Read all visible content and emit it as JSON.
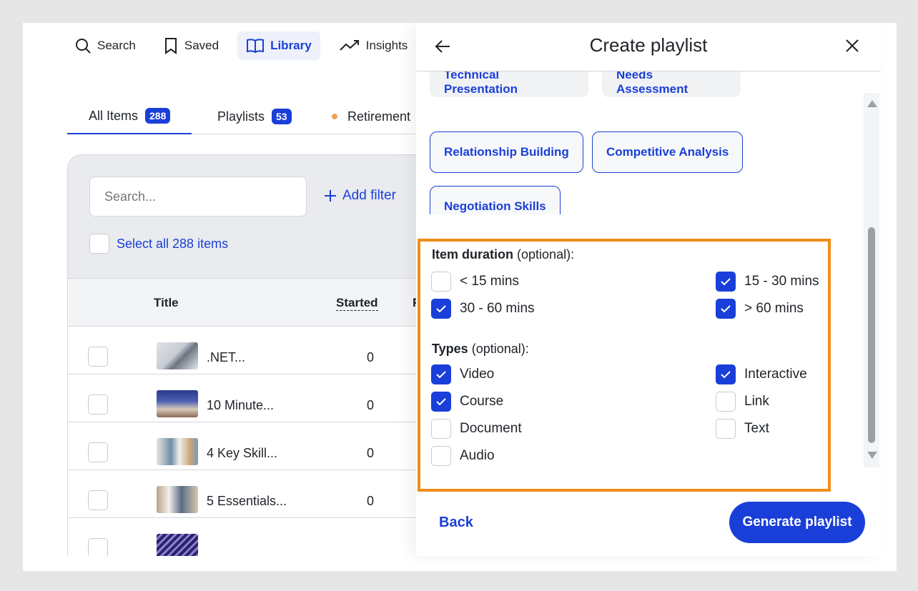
{
  "nav": {
    "items": [
      {
        "label": "Search",
        "icon": "search-icon",
        "active": false
      },
      {
        "label": "Saved",
        "icon": "bookmark-icon",
        "active": false
      },
      {
        "label": "Library",
        "icon": "book-icon",
        "active": true
      },
      {
        "label": "Insights",
        "icon": "trend-icon",
        "active": false
      }
    ]
  },
  "tabs": {
    "all_items": {
      "label": "All Items",
      "count": "288"
    },
    "playlists": {
      "label": "Playlists",
      "count": "53"
    },
    "retirement": {
      "label": "Retirement"
    }
  },
  "library": {
    "search_placeholder": "Search...",
    "add_filter": "Add filter",
    "select_all": "Select all 288 items",
    "columns": {
      "title": "Title",
      "started": "Started",
      "extra": "F"
    },
    "rows": [
      {
        "title": ".NET...",
        "started": "0"
      },
      {
        "title": "10 Minute...",
        "started": "0"
      },
      {
        "title": "4 Key Skill...",
        "started": "0"
      },
      {
        "title": "5 Essentials...",
        "started": "0"
      }
    ]
  },
  "drawer": {
    "title": "Create playlist",
    "chips": [
      "Technical Presentation",
      "Needs Assessment",
      "Relationship Building",
      "Competitive Analysis",
      "Negotiation Skills"
    ],
    "duration": {
      "label": "Item duration",
      "hint": "(optional):",
      "options": [
        {
          "label": "< 15 mins",
          "checked": false
        },
        {
          "label": "15 - 30 mins",
          "checked": true
        },
        {
          "label": "30 - 60 mins",
          "checked": true
        },
        {
          "label": "> 60 mins",
          "checked": true
        }
      ]
    },
    "types": {
      "label": "Types",
      "hint": "(optional):",
      "options": [
        {
          "label": "Video",
          "checked": true
        },
        {
          "label": "Interactive",
          "checked": true
        },
        {
          "label": "Course",
          "checked": true
        },
        {
          "label": "Link",
          "checked": false
        },
        {
          "label": "Document",
          "checked": false
        },
        {
          "label": "Text",
          "checked": false
        },
        {
          "label": "Audio",
          "checked": false
        }
      ]
    },
    "back_label": "Back",
    "generate_label": "Generate playlist"
  },
  "colors": {
    "accent": "#1a3fd8",
    "highlight_border": "#f08c1a"
  }
}
